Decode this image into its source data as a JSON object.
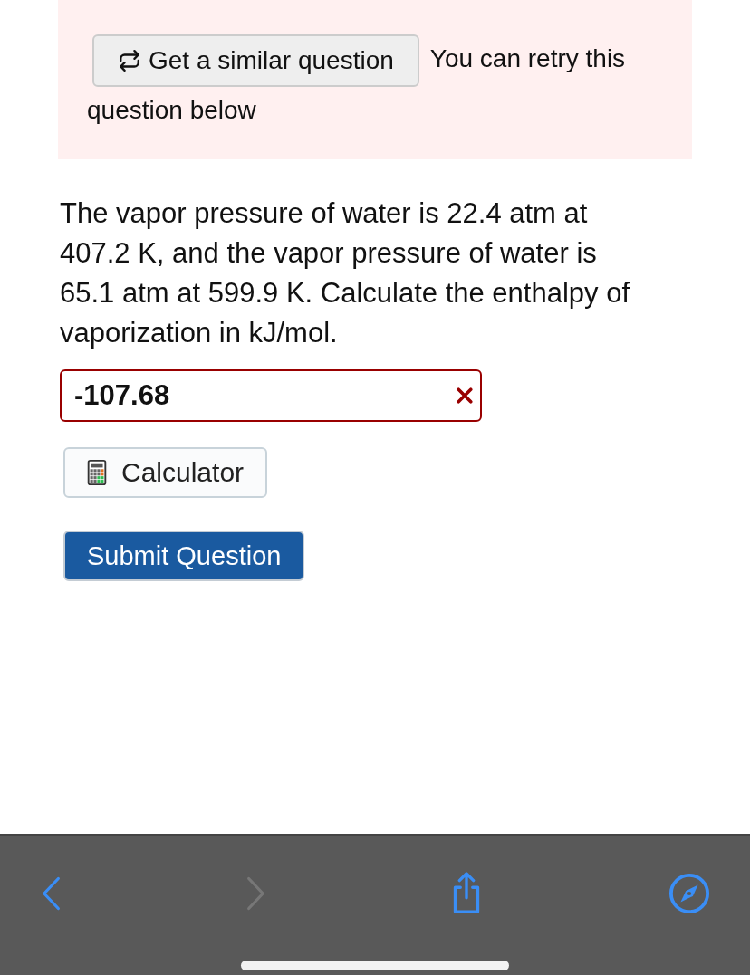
{
  "retry_banner": {
    "button": "Get a similar question",
    "text_line_1": "You can retry this",
    "text_line_2": "question below"
  },
  "question": "The vapor pressure of water is 22.4 atm at 407.2 K, and the vapor pressure of water is 65.1 atm at 599.9 K. Calculate the enthalpy of vaporization in kJ/mol.",
  "answer": {
    "value": "-107.68",
    "correct": false
  },
  "calculator_button": "Calculator",
  "submit_button": "Submit Question",
  "browser_toolbar": {
    "back_disabled": false,
    "forward_disabled": true
  }
}
